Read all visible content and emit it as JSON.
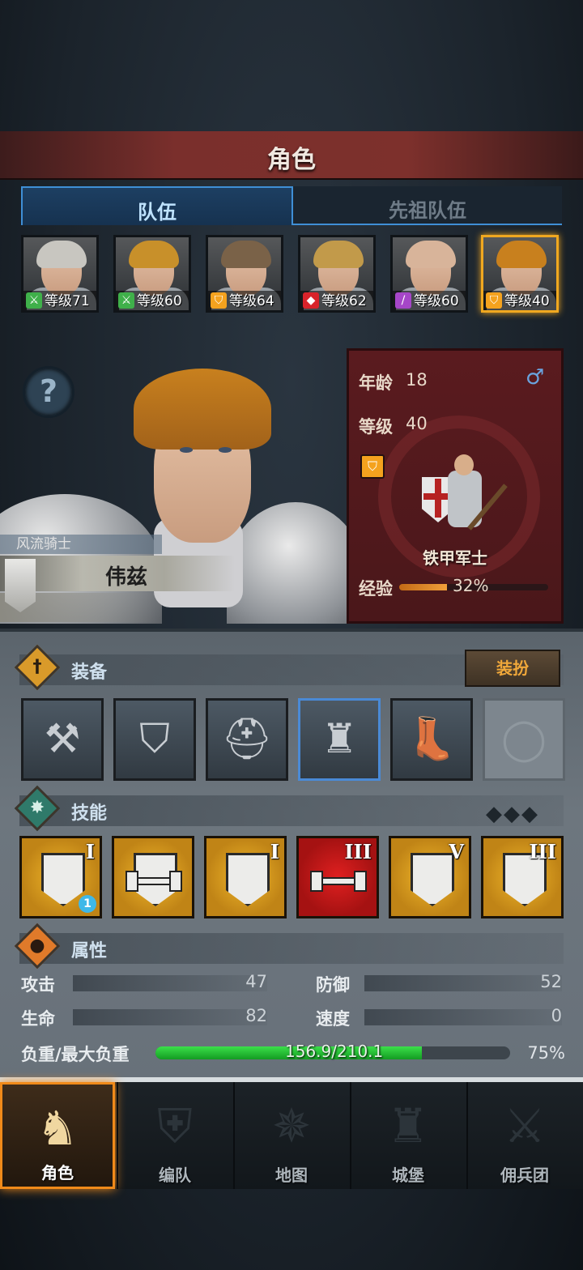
{
  "title": "角色",
  "tabs": [
    {
      "label": "队伍",
      "active": true
    },
    {
      "label": "先祖队伍",
      "active": false
    }
  ],
  "team": [
    {
      "level_text": "等级71",
      "class_icon": "crossed-swords-icon",
      "class_color": "#3fb04a",
      "hair_color": "#c8c6c0",
      "selected": false
    },
    {
      "level_text": "等级60",
      "class_icon": "crossed-swords-icon",
      "class_color": "#3fb04a",
      "hair_color": "#c8902a",
      "selected": false
    },
    {
      "level_text": "等级64",
      "class_icon": "shield-icon",
      "class_color": "#f4a21e",
      "hair_color": "#7a6248",
      "selected": false
    },
    {
      "level_text": "等级62",
      "class_icon": "wolf-icon",
      "class_color": "#d8232a",
      "hair_color": "#c29a4a",
      "selected": false
    },
    {
      "level_text": "等级60",
      "class_icon": "staff-icon",
      "class_color": "#a646c8",
      "hair_color": "#d8b49a",
      "selected": false
    },
    {
      "level_text": "等级40",
      "class_icon": "shield-icon",
      "class_color": "#f4a21e",
      "hair_color": "#c8801e",
      "selected": true
    }
  ],
  "hero": {
    "class_title": "风流骑士",
    "name": "伟兹"
  },
  "info": {
    "age_label": "年龄",
    "age": "18",
    "level_label": "等级",
    "level": "40",
    "gender_icon": "male-icon",
    "unit_name": "铁甲军士",
    "exp_label": "经验",
    "exp_percent": 32,
    "exp_text": "32%"
  },
  "equipment": {
    "title": "装备",
    "outfit_button": "装扮",
    "slots": [
      {
        "name": "war-hammer",
        "glyph": "⚒"
      },
      {
        "name": "kite-shield",
        "glyph": "⛉"
      },
      {
        "name": "great-helm",
        "glyph": "⛑"
      },
      {
        "name": "plate-armor",
        "glyph": "♜"
      },
      {
        "name": "greaves",
        "glyph": "👢"
      },
      {
        "name": "ring-empty",
        "glyph": "◯"
      }
    ]
  },
  "skills": {
    "title": "技能",
    "items": [
      {
        "tier": "I",
        "color": "gold",
        "type": "shield",
        "sub": "1"
      },
      {
        "tier": "",
        "color": "gold",
        "type": "dumbbell-shield",
        "sub": ""
      },
      {
        "tier": "I",
        "color": "gold",
        "type": "shield",
        "sub": ""
      },
      {
        "tier": "III",
        "color": "red",
        "type": "dumbbell",
        "sub": ""
      },
      {
        "tier": "V",
        "color": "gold",
        "type": "shield",
        "sub": ""
      },
      {
        "tier": "III",
        "color": "gold",
        "type": "shield",
        "sub": ""
      }
    ]
  },
  "attributes": {
    "title": "属性",
    "attack_label": "攻击",
    "attack": "47",
    "defense_label": "防御",
    "defense": "52",
    "hp_label": "生命",
    "hp": "82",
    "speed_label": "速度",
    "speed": "0",
    "load_label": "负重/最大负重",
    "load_text": "156.9/210.1",
    "load_percent": 75,
    "load_percent_text": "75%"
  },
  "nav": [
    {
      "label": "角色",
      "active": true,
      "glyph": "♞"
    },
    {
      "label": "编队",
      "active": false,
      "glyph": "⛨"
    },
    {
      "label": "地图",
      "active": false,
      "glyph": "✵"
    },
    {
      "label": "城堡",
      "active": false,
      "glyph": "♜"
    },
    {
      "label": "佣兵团",
      "active": false,
      "glyph": "⚔"
    }
  ]
}
